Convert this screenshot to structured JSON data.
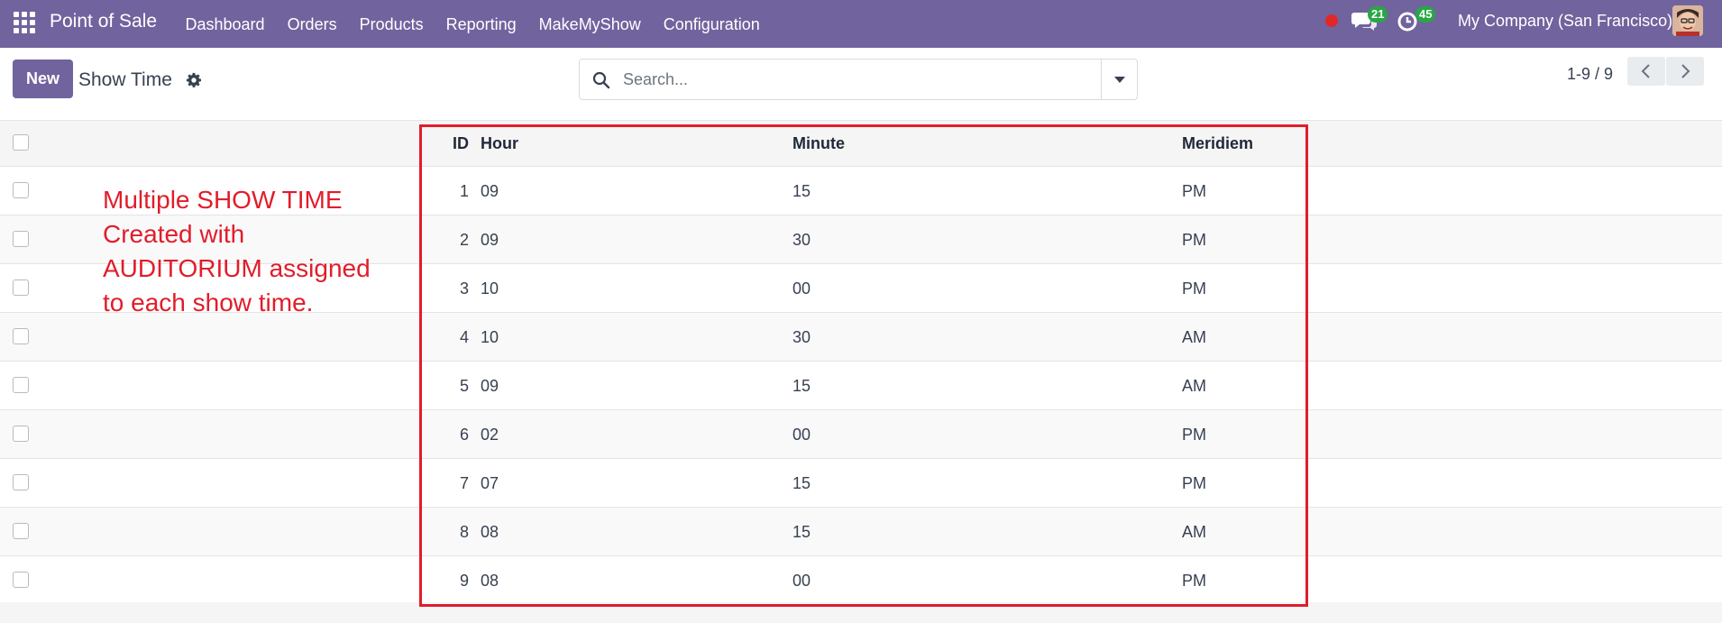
{
  "navbar": {
    "app_name": "Point of Sale",
    "menu": [
      "Dashboard",
      "Orders",
      "Products",
      "Reporting",
      "MakeMyShow",
      "Configuration"
    ],
    "chat_count": "21",
    "activity_count": "45",
    "company": "My Company (San Francisco)",
    "colors": {
      "brand": "#71639e",
      "badge": "#28a745",
      "recording": "#e02828"
    },
    "icons": [
      "apps-grid-icon",
      "recording-dot-icon",
      "chat-icon",
      "activity-clock-icon",
      "user-avatar"
    ]
  },
  "control_panel": {
    "new_label": "New",
    "title": "Show Time",
    "search_placeholder": "Search...",
    "pager": "1-9 / 9",
    "icons": [
      "gear-icon",
      "search-icon",
      "caret-down-icon",
      "chevron-left-icon",
      "chevron-right-icon"
    ]
  },
  "table": {
    "columns": {
      "id": "ID",
      "hour": "Hour",
      "minute": "Minute",
      "meridiem": "Meridiem"
    },
    "rows": [
      {
        "id": "1",
        "hour": "09",
        "minute": "15",
        "meridiem": "PM"
      },
      {
        "id": "2",
        "hour": "09",
        "minute": "30",
        "meridiem": "PM"
      },
      {
        "id": "3",
        "hour": "10",
        "minute": "00",
        "meridiem": "PM"
      },
      {
        "id": "4",
        "hour": "10",
        "minute": "30",
        "meridiem": "AM"
      },
      {
        "id": "5",
        "hour": "09",
        "minute": "15",
        "meridiem": "AM"
      },
      {
        "id": "6",
        "hour": "02",
        "minute": "00",
        "meridiem": "PM"
      },
      {
        "id": "7",
        "hour": "07",
        "minute": "15",
        "meridiem": "PM"
      },
      {
        "id": "8",
        "hour": "08",
        "minute": "15",
        "meridiem": "AM"
      },
      {
        "id": "9",
        "hour": "08",
        "minute": "00",
        "meridiem": "PM"
      }
    ]
  },
  "annotation": {
    "lines": [
      "Multiple SHOW TIME",
      "Created with",
      "AUDITORIUM assigned",
      "to each show time."
    ],
    "color": "#e11d2a"
  }
}
